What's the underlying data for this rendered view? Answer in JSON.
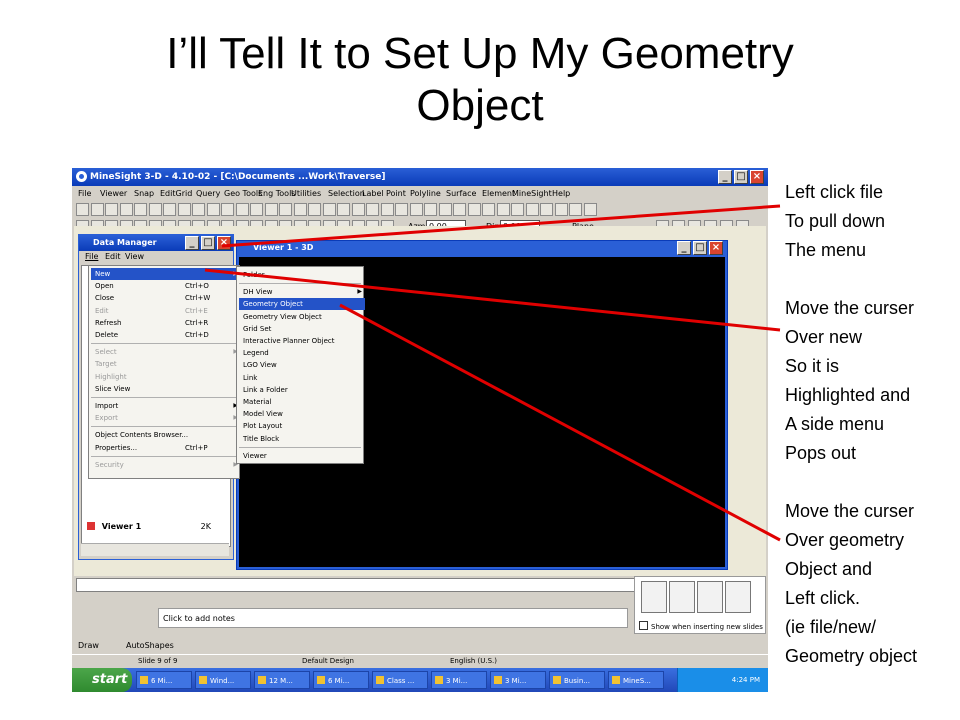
{
  "slide": {
    "title_line1": "I’ll Tell It to Set Up My Geometry",
    "title_line2": "Object"
  },
  "notes": [
    "Left click file",
    "To pull down",
    "The menu",
    "",
    "Move the curser",
    "Over new",
    "So it is",
    "Highlighted and",
    "A side menu",
    "Pops out",
    "",
    "Move the curser",
    "Over geometry",
    "Object and",
    "Left click.",
    "(ie file/new/",
    "Geometry object"
  ],
  "app": {
    "title": "MineSight 3-D - 4.10-02 - [C:\\Documents ...Work\\Traverse]",
    "menus": [
      "File",
      "Viewer",
      "Snap",
      "EditGrid",
      "Query",
      "Geo Tools",
      "Eng Tools",
      "Utilities",
      "Selection",
      "Label",
      "Point",
      "Polyline",
      "Surface",
      "Element",
      "MineSight",
      "Help"
    ],
    "toolbar2": {
      "azm_label": "Azm",
      "azm_value": "0.00",
      "dip_label": "Dip",
      "dip_value": "0.00",
      "plane_label": "Plane"
    }
  },
  "data_manager": {
    "title": "Data Manager",
    "menus": [
      "File",
      "Edit",
      "View"
    ],
    "row": {
      "name": "Viewer 1",
      "size": "2K"
    }
  },
  "viewer": {
    "title": "Viewer 1 - 3D"
  },
  "file_menu": [
    {
      "label": "New",
      "shortcut": "",
      "submenu": true,
      "state": "highlight"
    },
    {
      "label": "Open",
      "shortcut": "Ctrl+O"
    },
    {
      "label": "Close",
      "shortcut": "Ctrl+W"
    },
    {
      "label": "Edit",
      "shortcut": "Ctrl+E",
      "state": "disabled"
    },
    {
      "label": "Refresh",
      "shortcut": "Ctrl+R"
    },
    {
      "label": "Delete",
      "shortcut": "Ctrl+D"
    },
    {
      "label": "Select",
      "submenu": true,
      "state": "disabled"
    },
    {
      "label": "Target",
      "state": "disabled"
    },
    {
      "label": "Highlight",
      "state": "disabled"
    },
    {
      "label": "Slice View"
    },
    {
      "label": "Import",
      "submenu": true
    },
    {
      "label": "Export",
      "submenu": true,
      "state": "disabled"
    },
    {
      "label": "Object Contents Browser..."
    },
    {
      "label": "Properties...",
      "shortcut": "Ctrl+P"
    },
    {
      "label": "Security",
      "submenu": true,
      "state": "disabled"
    }
  ],
  "new_menu": [
    {
      "label": "Folder"
    },
    {
      "label": "DH View",
      "submenu": true
    },
    {
      "label": "Geometry Object",
      "state": "highlight"
    },
    {
      "label": "Geometry View Object"
    },
    {
      "label": "Grid Set"
    },
    {
      "label": "Interactive Planner Object"
    },
    {
      "label": "Legend"
    },
    {
      "label": "LGO View"
    },
    {
      "label": "Link"
    },
    {
      "label": "Link a Folder"
    },
    {
      "label": "Material"
    },
    {
      "label": "Model View"
    },
    {
      "label": "Plot Layout"
    },
    {
      "label": "Title Block"
    },
    {
      "label": "Viewer"
    }
  ],
  "powerpoint": {
    "notes_placeholder": "Click to add notes",
    "show_checkbox": "Show when inserting new slides",
    "draw_label": "Draw",
    "autoshapes_label": "AutoShapes",
    "status": {
      "slide": "Slide 9 of 9",
      "design": "Default Design",
      "language": "English (U.S.)"
    }
  },
  "taskbar": {
    "start": "start",
    "tasks": [
      "6 Mi...",
      "Wind...",
      "12 M...",
      "6 Mi...",
      "Class ...",
      "3 Mi...",
      "3 Mi...",
      "Busin...",
      "MineS..."
    ],
    "clock": "4:24 PM"
  },
  "colors": {
    "arrow": "#e00000",
    "highlight": "#2453c8",
    "titlebar": "#2a5fd6"
  }
}
